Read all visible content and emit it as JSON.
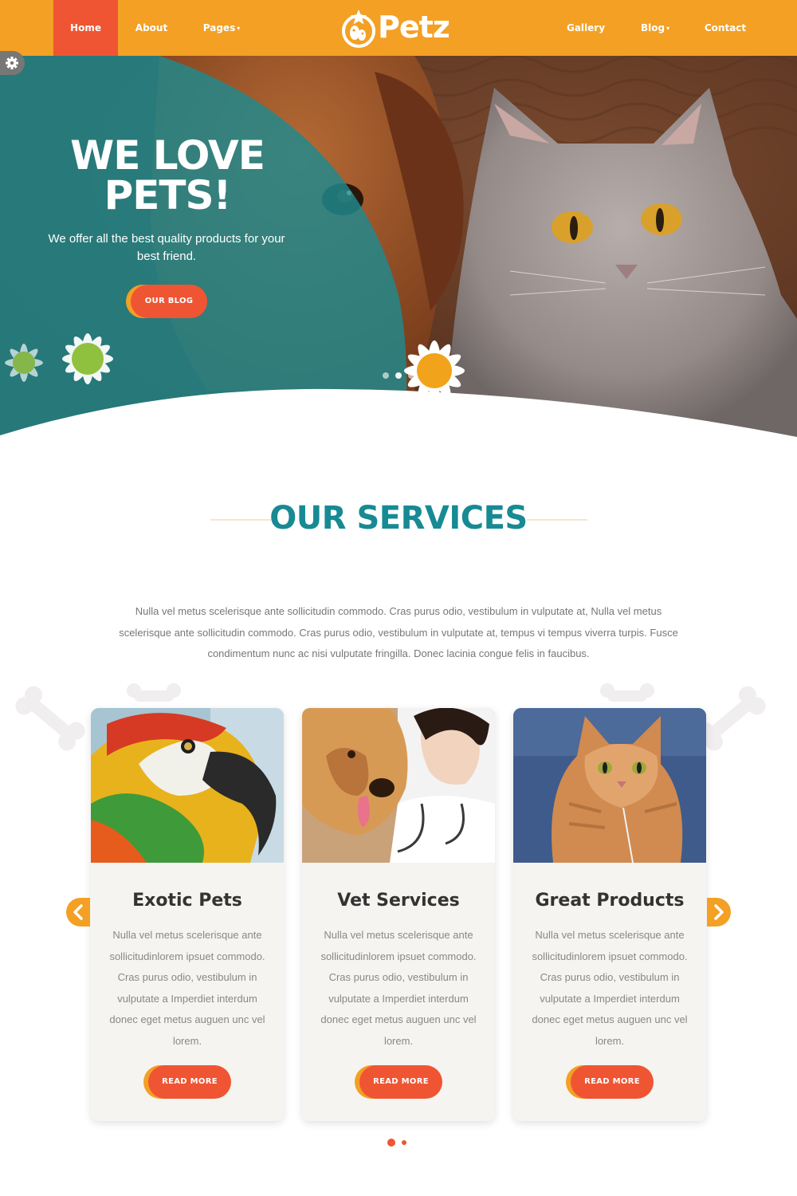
{
  "nav": {
    "items": [
      {
        "label": "Home"
      },
      {
        "label": "About"
      },
      {
        "label": "Pages"
      },
      {
        "label": "Gallery"
      },
      {
        "label": "Blog"
      },
      {
        "label": "Contact"
      }
    ],
    "logo_text": "Petz"
  },
  "hero": {
    "title_line1": "WE LOVE",
    "title_line2": "PETS!",
    "subtitle": "We offer all the best quality products for your best friend.",
    "button_label": "OUR BLOG",
    "slide_count": 3,
    "active_slide": 1
  },
  "services": {
    "title": "OUR SERVICES",
    "intro": "Nulla vel metus scelerisque ante sollicitudin commodo. Cras purus odio, vestibulum in vulputate at, Nulla vel metus scelerisque ante sollicitudin commodo. Cras purus odio, vestibulum in vulputate at, tempus vi tempus viverra turpis. Fusce condimentum nunc ac nisi vulputate fringilla. Donec lacinia congue felis in faucibus.",
    "cards": [
      {
        "title": "Exotic Pets",
        "text": "Nulla vel metus scelerisque ante sollicitudinlorem ipsuet commodo. Cras purus odio, vestibulum in vulputate a Imperdiet interdum donec eget metus auguen unc vel lorem.",
        "button": "READ MORE"
      },
      {
        "title": "Vet Services",
        "text": "Nulla vel metus scelerisque ante sollicitudinlorem ipsuet commodo. Cras purus odio, vestibulum in vulputate a Imperdiet interdum donec eget metus auguen unc vel lorem.",
        "button": "READ MORE"
      },
      {
        "title": "Great Products",
        "text": "Nulla vel metus scelerisque ante sollicitudinlorem ipsuet commodo. Cras purus odio, vestibulum in vulputate a Imperdiet interdum donec eget metus auguen unc vel lorem.",
        "button": "READ MORE"
      }
    ],
    "page_count": 2,
    "active_page": 1
  },
  "icons": {
    "settings": "gear-icon",
    "prev": "chevron-left-icon",
    "next": "chevron-right-icon",
    "decor": "bone-icon"
  },
  "colors": {
    "nav_bg": "#f3a024",
    "accent": "#ef5533",
    "title_teal": "#178a93",
    "card_bg": "#f5f4f0"
  }
}
